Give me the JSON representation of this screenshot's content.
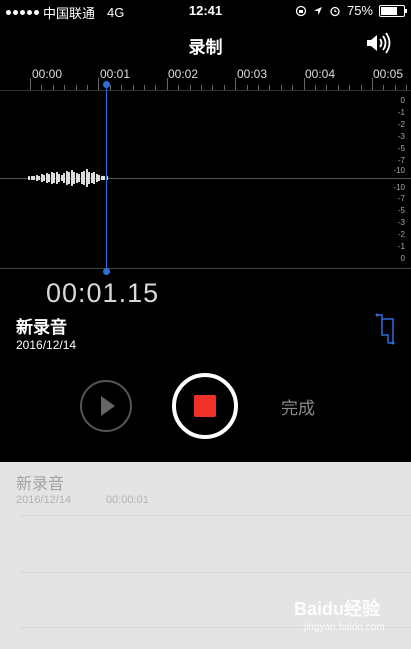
{
  "status_bar": {
    "carrier": "中国联通",
    "network": "4G",
    "time": "12:41",
    "battery": "75%",
    "battery_level": 0.75
  },
  "nav": {
    "title": "录制",
    "speaker_icon": "speaker-volume-icon"
  },
  "timeline": {
    "ticks": [
      "00:00",
      "00:01",
      "00:02",
      "00:03",
      "00:04",
      "00:05"
    ]
  },
  "db_scale": {
    "upper": [
      "0",
      "-1",
      "-2",
      "-3",
      "-5",
      "-7",
      "-10"
    ],
    "lower": [
      "-10",
      "-7",
      "-5",
      "-3",
      "-2",
      "-1",
      "0"
    ]
  },
  "recording": {
    "elapsed": "00:01.15",
    "title": "新录音",
    "date": "2016/12/14"
  },
  "controls": {
    "done_label": "完成",
    "play_icon": "play-icon",
    "stop_icon": "stop-icon"
  },
  "list": {
    "items": [
      {
        "title": "新录音",
        "date": "2016/12/14",
        "duration": "00:00:01"
      }
    ]
  },
  "watermark": {
    "text": "Baidu经验",
    "url": "jingyan.baidu.com"
  },
  "colors": {
    "accent": "#2f6dd9",
    "record": "#f2302a",
    "list_bg": "#e4e4e4"
  }
}
